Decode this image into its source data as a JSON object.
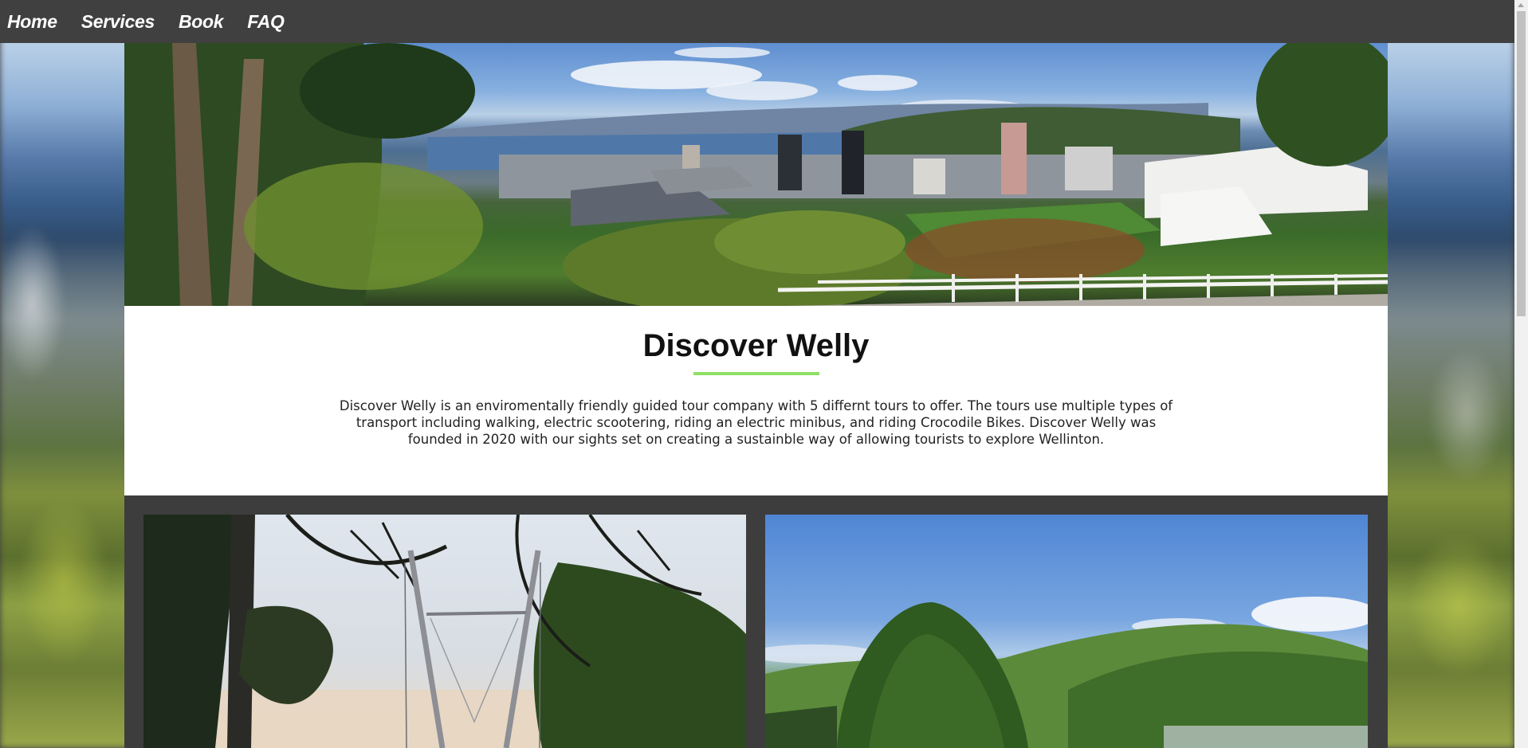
{
  "nav": {
    "items": [
      {
        "label": "Home"
      },
      {
        "label": "Services"
      },
      {
        "label": "Book"
      },
      {
        "label": "FAQ"
      }
    ]
  },
  "about": {
    "title": "Discover Welly",
    "description": "Discover Welly is an enviromentally friendly guided tour company with 5 differnt tours to offer. The tours use multiple types of transport including walking, electric scootering, riding an electric minibus, and riding Crocodile Bikes. Discover Welly was founded in 2020 with our sights set on creating a sustainble way of allowing tourists to explore Wellinton."
  },
  "colors": {
    "nav_background": "#404040",
    "nav_text": "#ffffff",
    "accent_underline": "#8ee063",
    "page_background": "#3d3d3d"
  },
  "gallery": {
    "images": [
      {
        "name": "bridge-through-trees-photo"
      },
      {
        "name": "green-hills-photo"
      }
    ]
  }
}
